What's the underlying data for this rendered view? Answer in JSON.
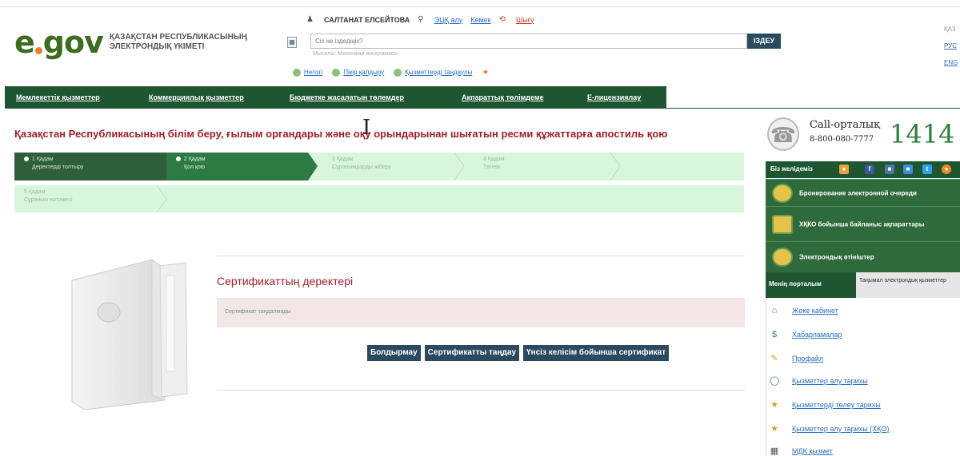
{
  "header": {
    "logo_text": "egov",
    "logo_title": "ҚАЗАҚСТАН РЕСПУБЛИКАСЫНЫҢ ЭЛЕКТРОНДЫҚ ҮКІМЕТІ",
    "user_name": "САЛТАНАТ ЕЛСЕЙТОВА",
    "link_eds": "ЭЦҚ алу",
    "link_help": "Көмек",
    "link_exit": "Шығу",
    "search_placeholder": "Сіз не іздедіңіз?",
    "search_hint": "Мысалы: Мекенжай анықтамасы",
    "search_button": "ІЗДЕУ",
    "quick_home": "Негізгі",
    "quick_opinion": "Пікір қалдыру",
    "quick_favorites": "Қызметтерді таңдаулы",
    "langs": [
      "ҚАЗ",
      "РУС",
      "ENG"
    ]
  },
  "nav": {
    "items": [
      "Мемлекеттік қызметтер",
      "Коммерциялық қызметтер",
      "Бюджетке жасалатын төлемдер",
      "Ақпараттық төлімдеме",
      "E-лицензиялау"
    ]
  },
  "page": {
    "title": "Қазақстан Республикасының білім беру, ғылым органдары және оқу орындарынан шығатын ресми құжаттарға апостиль қою"
  },
  "steps": [
    {
      "num": "1 Қадам",
      "label": "Деректерді толтыру",
      "state": "done"
    },
    {
      "num": "2 Қадам",
      "label": "Қол қою",
      "state": "active"
    },
    {
      "num": "3 Қадам",
      "label": "Сұранымдарды жіберу",
      "state": "pending"
    },
    {
      "num": "4 Қадам",
      "label": "Төлем",
      "state": "pending"
    },
    {
      "num": "5 Қадам",
      "label": "Сұраным нәтижесі",
      "state": "pending"
    }
  ],
  "certificate": {
    "title": "Сертификаттың деректері",
    "empty_text": "Сертификат таңдалмады",
    "btn_cancel": "Болдырмау",
    "btn_choose": "Сертификатты таңдау",
    "btn_default": "Үнсіз келісім бойынша сертификат"
  },
  "sidebar": {
    "call_label": "Call-орталық",
    "call_phone": "8-800-080-7777",
    "call_short": "1414",
    "social_label": "Біз желідеміз",
    "items": [
      "Бронирование электронной очереди",
      "ХҚКО бойынша байланыс ақпараттары",
      "Электрондық өтініштер"
    ],
    "tab_portal": "Менің порталым",
    "tab_services": "Таңымал электрондық қызметтер",
    "portal_links": [
      "Жеке кабинет",
      "Хабарламалар",
      "Профайл",
      "Қызметтер алу тарихы",
      "Қызметтерді төлеу тарихы",
      "Қызметтер алу тарихы (ХҚО)",
      "МДК қызмет"
    ]
  }
}
